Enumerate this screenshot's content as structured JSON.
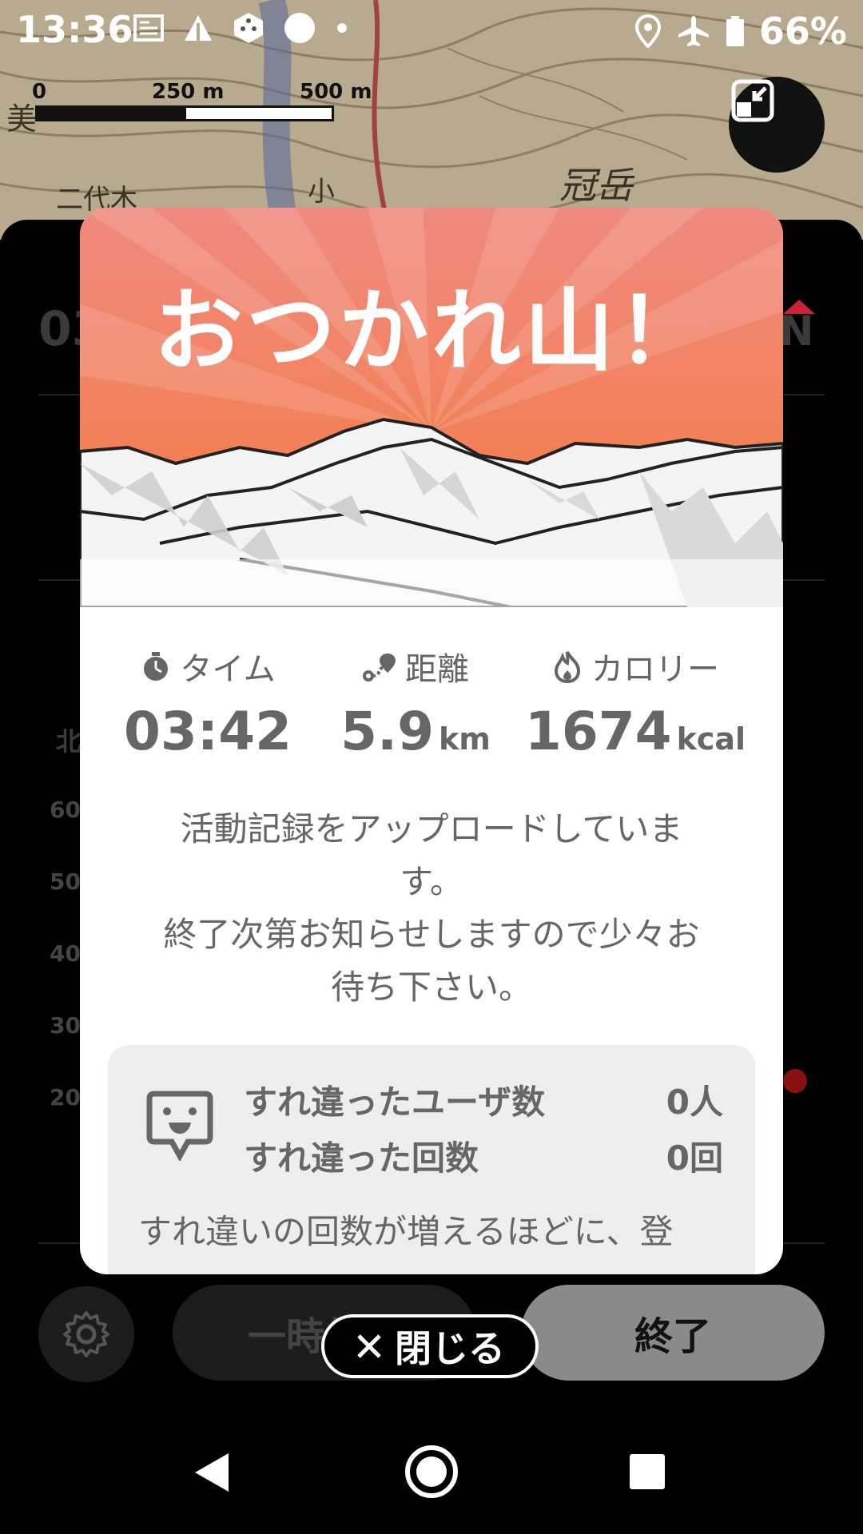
{
  "status_bar": {
    "time": "13:36",
    "battery_text": "66%",
    "icons": [
      "news-icon",
      "triangle-app-icon",
      "dice-app-icon",
      "circle-icon",
      "dot-icon",
      "location-icon",
      "airplane-mode-icon",
      "battery-icon"
    ]
  },
  "map": {
    "scale_labels": [
      "0",
      "250 m",
      "500 m"
    ],
    "labels": [
      "美",
      "二代木",
      "冠岳",
      "小"
    ]
  },
  "background_panel": {
    "partial_time": "03",
    "partial_badge": "N",
    "axis_partial": [
      "北",
      "60",
      "50",
      "40",
      "30",
      "20"
    ],
    "pause_label": "一時停止",
    "end_label": "終了"
  },
  "modal": {
    "title": "おつかれ山！",
    "stats": {
      "time": {
        "label": "タイム",
        "value": "03:42"
      },
      "distance": {
        "label": "距離",
        "value": "5.9",
        "unit": "km"
      },
      "calories": {
        "label": "カロリー",
        "value": "1674",
        "unit": "kcal"
      }
    },
    "message_line1": "活動記録をアップロードしていま",
    "message_line2": "す。",
    "message_line3": "終了次第お知らせしますので少々お",
    "message_line4": "待ち下さい。",
    "passing": {
      "users_label": "すれ違ったユーザ数",
      "users_value": "0人",
      "count_label": "すれ違った回数",
      "count_value": "0回",
      "note": "すれ違いの回数が増えるほどに、登"
    }
  },
  "close_label": "閉じる",
  "colors": {
    "hero_top": "#f08a80",
    "hero_bottom": "#f47a3c",
    "text_gray": "#666666",
    "end_button": "#8a8a8a"
  }
}
